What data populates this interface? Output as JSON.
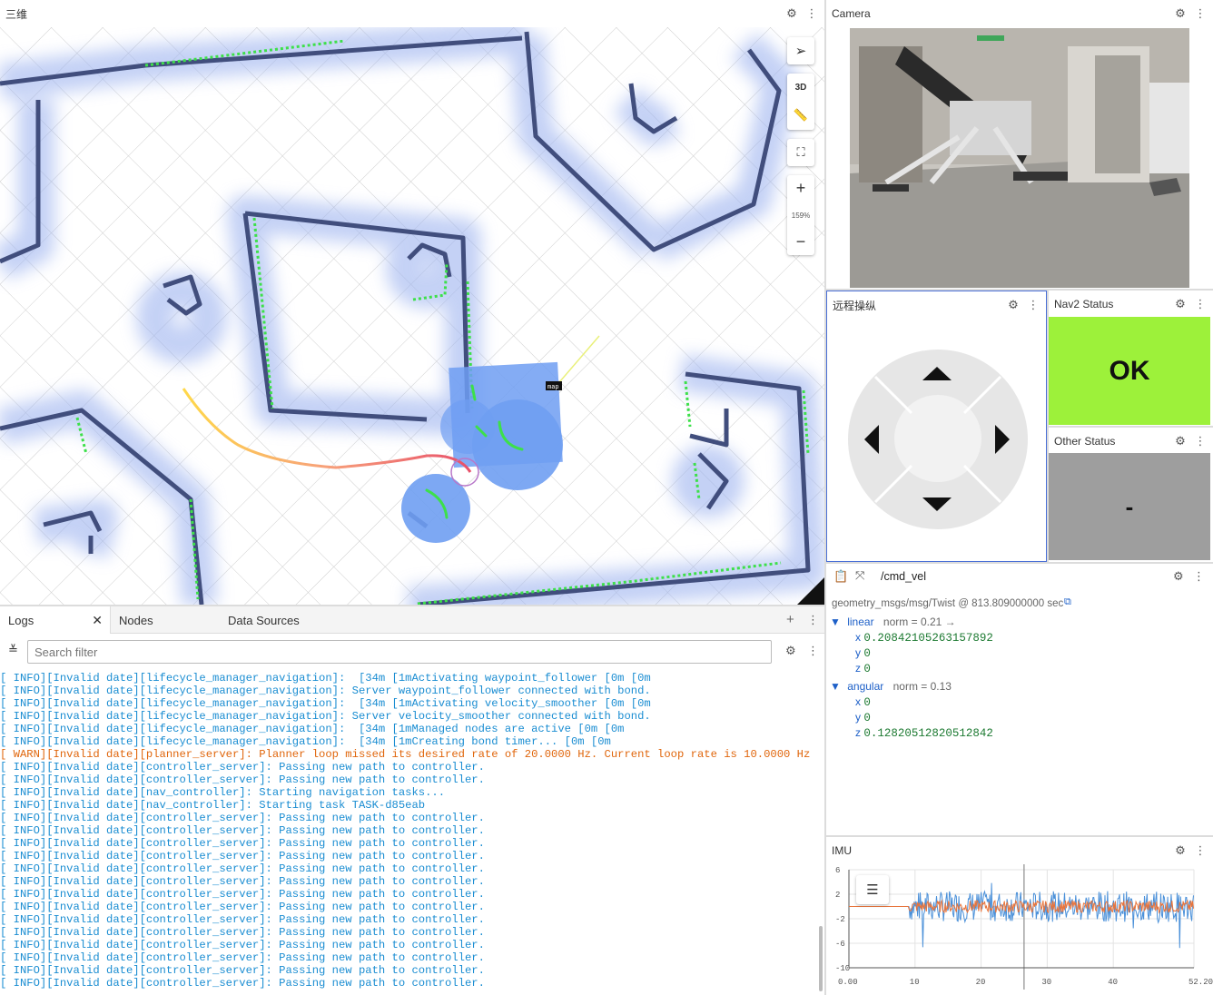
{
  "map_panel": {
    "title": "三维",
    "mode_3d": "3D",
    "zoom": "159%",
    "frame_label": "map"
  },
  "camera_panel": {
    "title": "Camera"
  },
  "teleop_panel": {
    "title": "远程操纵"
  },
  "nav2_panel": {
    "title": "Nav2 Status",
    "value": "OK",
    "color": "#9df13a"
  },
  "other_panel": {
    "title": "Other Status",
    "value": "-",
    "color": "#9e9e9e"
  },
  "raw_panel": {
    "topic": "/cmd_vel",
    "schema": "geometry_msgs/msg/Twist @ 813.809000000 sec",
    "linear": {
      "label": "linear",
      "norm": "norm = 0.21 →",
      "x": "0.20842105263157892",
      "y": "0",
      "z": "0"
    },
    "angular": {
      "label": "angular",
      "norm": "norm = 0.13",
      "x": "0",
      "y": "0",
      "z": "0.12820512820512842"
    },
    "keys": {
      "x": "x",
      "y": "y",
      "z": "z"
    }
  },
  "imu_panel": {
    "title": "IMU",
    "y_ticks": [
      "6",
      "2",
      "-2",
      "-6",
      "-10"
    ],
    "x_ticks": [
      "0.00",
      "10",
      "20",
      "30",
      "40",
      "52.20"
    ]
  },
  "chart_data": {
    "type": "line",
    "xlim": [
      0,
      52.2
    ],
    "ylim": [
      -10,
      6
    ],
    "series": [
      {
        "color": "#4a90d9",
        "flat_until": 9,
        "flat_value": 0,
        "amplitude": 2.5
      },
      {
        "color": "#e8743b",
        "flat_until": 9,
        "flat_value": 0,
        "amplitude": 1
      }
    ]
  },
  "logs_panel": {
    "tabs": [
      "Logs",
      "Nodes",
      "Data Sources"
    ],
    "filter_placeholder": "Search filter",
    "lines": [
      {
        "level": "info",
        "text": "[ INFO][Invalid date][lifecycle_manager_navigation]:  [34m [1mActivating waypoint_follower [0m [0m"
      },
      {
        "level": "info",
        "text": "[ INFO][Invalid date][lifecycle_manager_navigation]: Server waypoint_follower connected with bond."
      },
      {
        "level": "info",
        "text": "[ INFO][Invalid date][lifecycle_manager_navigation]:  [34m [1mActivating velocity_smoother [0m [0m"
      },
      {
        "level": "info",
        "text": "[ INFO][Invalid date][lifecycle_manager_navigation]: Server velocity_smoother connected with bond."
      },
      {
        "level": "info",
        "text": "[ INFO][Invalid date][lifecycle_manager_navigation]:  [34m [1mManaged nodes are active [0m [0m"
      },
      {
        "level": "info",
        "text": "[ INFO][Invalid date][lifecycle_manager_navigation]:  [34m [1mCreating bond timer... [0m [0m"
      },
      {
        "level": "warn",
        "text": "[ WARN][Invalid date][planner_server]: Planner loop missed its desired rate of 20.0000 Hz. Current loop rate is 10.0000 Hz"
      },
      {
        "level": "info",
        "text": "[ INFO][Invalid date][controller_server]: Passing new path to controller."
      },
      {
        "level": "info",
        "text": "[ INFO][Invalid date][controller_server]: Passing new path to controller."
      },
      {
        "level": "info",
        "text": "[ INFO][Invalid date][nav_controller]: Starting navigation tasks..."
      },
      {
        "level": "info",
        "text": "[ INFO][Invalid date][nav_controller]: Starting task TASK-d85eab"
      },
      {
        "level": "info",
        "text": "[ INFO][Invalid date][controller_server]: Passing new path to controller."
      },
      {
        "level": "info",
        "text": "[ INFO][Invalid date][controller_server]: Passing new path to controller."
      },
      {
        "level": "info",
        "text": "[ INFO][Invalid date][controller_server]: Passing new path to controller."
      },
      {
        "level": "info",
        "text": "[ INFO][Invalid date][controller_server]: Passing new path to controller."
      },
      {
        "level": "info",
        "text": "[ INFO][Invalid date][controller_server]: Passing new path to controller."
      },
      {
        "level": "info",
        "text": "[ INFO][Invalid date][controller_server]: Passing new path to controller."
      },
      {
        "level": "info",
        "text": "[ INFO][Invalid date][controller_server]: Passing new path to controller."
      },
      {
        "level": "info",
        "text": "[ INFO][Invalid date][controller_server]: Passing new path to controller."
      },
      {
        "level": "info",
        "text": "[ INFO][Invalid date][controller_server]: Passing new path to controller."
      },
      {
        "level": "info",
        "text": "[ INFO][Invalid date][controller_server]: Passing new path to controller."
      },
      {
        "level": "info",
        "text": "[ INFO][Invalid date][controller_server]: Passing new path to controller."
      },
      {
        "level": "info",
        "text": "[ INFO][Invalid date][controller_server]: Passing new path to controller."
      },
      {
        "level": "info",
        "text": "[ INFO][Invalid date][controller_server]: Passing new path to controller."
      },
      {
        "level": "info",
        "text": "[ INFO][Invalid date][controller_server]: Passing new path to controller."
      }
    ]
  }
}
